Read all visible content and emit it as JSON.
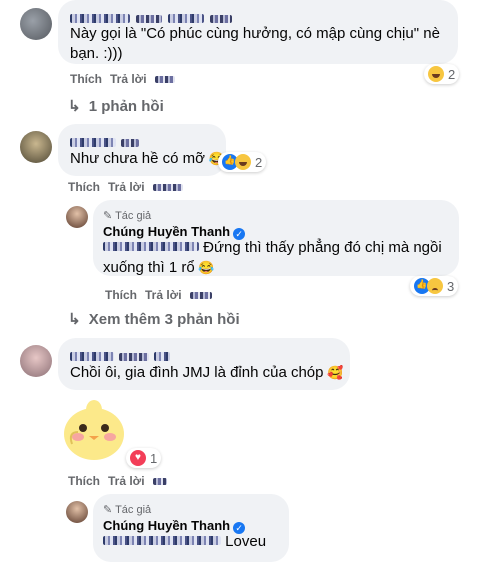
{
  "comments": [
    {
      "text": "Này gọi là \"Có phúc cùng hưởng, có mập cùng chịu\" nè bạn. :)))",
      "reaction_count": "2",
      "actions": {
        "like": "Thích",
        "reply": "Trả lời"
      },
      "reply_link": "1 phản hồi"
    },
    {
      "text": "Như chưa hề có mỡ",
      "reaction_count": "2",
      "actions": {
        "like": "Thích",
        "reply": "Trả lời"
      },
      "reply": {
        "author_tag": "Tác giả",
        "author_name": "Chúng Huyền Thanh",
        "text": "Đứng thì thấy phẳng đó chị mà ngồi xuống thì 1 rổ",
        "reaction_count": "3",
        "actions": {
          "like": "Thích",
          "reply": "Trả lời"
        }
      },
      "more_replies": "Xem thêm 3 phản hồi"
    },
    {
      "text": "Chồi ôi, gia đình JMJ là đỉnh của chóp",
      "sticker_reaction_count": "1",
      "actions": {
        "like": "Thích",
        "reply": "Trả lời"
      },
      "reply": {
        "author_tag": "Tác giả",
        "author_name": "Chúng Huyền Thanh",
        "text": "Loveu"
      }
    }
  ],
  "icons": {
    "reply_arrow": "reply-arrow-icon",
    "pencil": "pencil-icon",
    "verified": "verified-badge-icon",
    "haha": "haha-reaction-icon",
    "like": "like-reaction-icon",
    "love": "love-reaction-icon",
    "sad": "sad-reaction-icon"
  },
  "colors": {
    "bubble": "#f0f2f5",
    "meta": "#65676b",
    "verified": "#1877f2"
  }
}
